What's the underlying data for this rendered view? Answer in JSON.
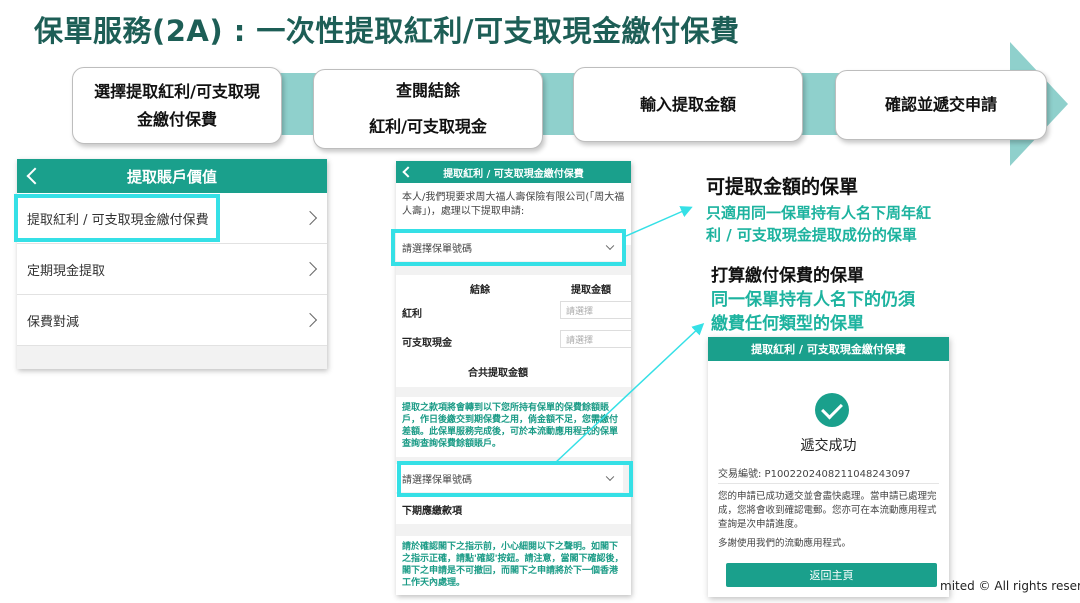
{
  "title": "保單服務(2A) : 一次性提取紅利/可支取現金繳付保費",
  "steps": [
    {
      "line1": "選擇提取紅利/可支取現",
      "line2": "金繳付保費"
    },
    {
      "line1": "查閱結餘",
      "line2": "紅利/可支取現金"
    },
    {
      "line1": "輸入提取金額"
    },
    {
      "line1": "確認並遞交申請"
    }
  ],
  "panel_a": {
    "header": "提取賬戶價值",
    "items": [
      "提取紅利 / 可支取現金繳付保費",
      "定期現金提取",
      "保費對減"
    ]
  },
  "panel_b": {
    "header": "提取紅利 / 可支取現金繳付保費",
    "intro": "本人/我們現要求周大福人壽保險有限公司(「周大福人壽」)，處理以下提取申請:",
    "select_placeholder": "請選擇保單號碼",
    "col_balance": "結餘",
    "col_amount": "提取金額",
    "row1": "紅利",
    "row2": "可支取現金",
    "input_placeholder": "請選擇",
    "total": "合共提取金額",
    "notice": "提取之款項將會轉到以下您所持有保單的保費餘額賬戶，作日後繳交到期保費之用，倘金額不足，您需繳付差額。此保單服務完成後，可於本流動應用程式的保單查詢查詢保費餘額賬戶。",
    "select2_placeholder": "請選擇保單號碼",
    "next_due": "下期應繳款項",
    "disclaimer": "請於確認閣下之指示前，小心細閱以下之聲明。如閣下之指示正確，請點'確認'按鈕。請注意，當閣下確認後，閣下之申請是不可撤回，而閣下之申請將於下一個香港工作天內處理。"
  },
  "annotations": {
    "a1_title": "可提取金額的保單",
    "a1_line1": "只適用同一保單持有人名下周年紅",
    "a1_line2": "利 / 可支取現金提取成份的保單",
    "a2_title": "打算繳付保費的保單",
    "a2_line1": "同一保單持有人名下的仍須",
    "a2_line2": "繳費任何類型的保單"
  },
  "panel_c": {
    "header": "提取紅利 / 可支取現金繳付保費",
    "success": "遞交成功",
    "ref": "交易編號: P100220240821104824309​7",
    "message": "您的申請已成功遞交並會盡快處理。當申請已處理完成，您將會收到確認電郵。您亦可在本流動應用程式查詢是次申請進度。",
    "thanks": "多謝使用我們的流動應用程式。",
    "button": "返回主頁"
  },
  "footer": "mited © All rights reserv",
  "colors": {
    "title": "#1d5e56",
    "teal": "#1aa08c",
    "band": "#8fd0cc",
    "highlight": "#35e0e6",
    "annotation_teal": "#1db39f"
  }
}
